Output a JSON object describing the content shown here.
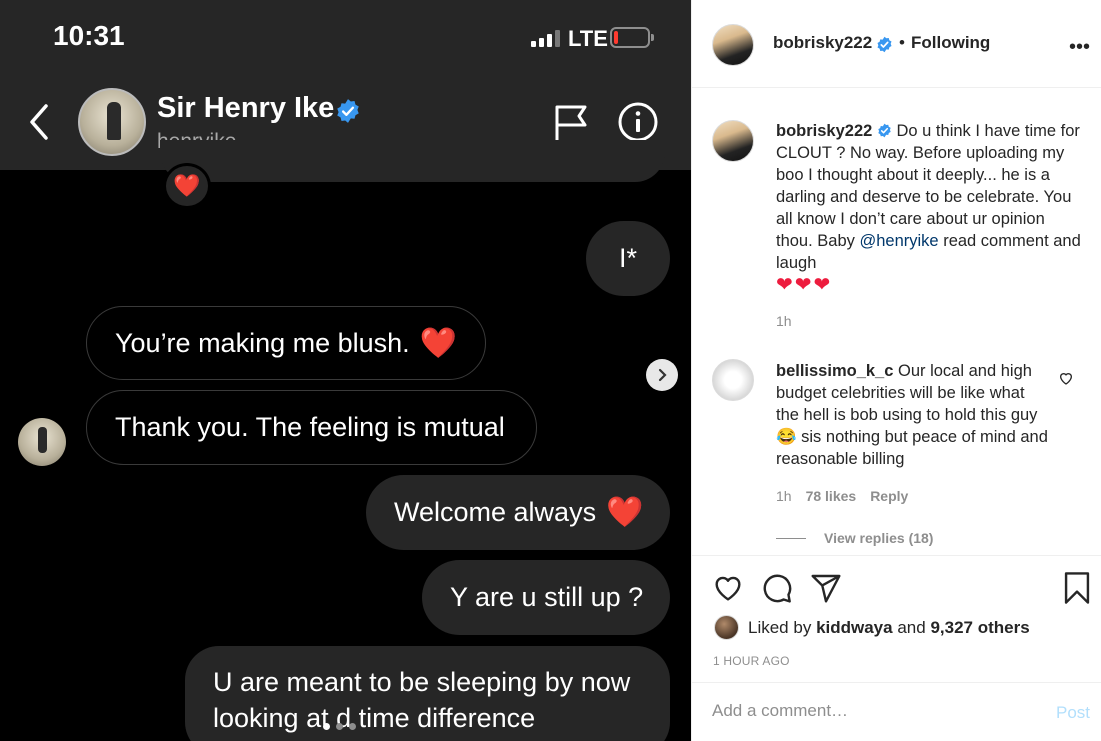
{
  "phone": {
    "status_time": "10:31",
    "network": "LTE",
    "battery_level": 0.1,
    "battery_color": "#ff3b30",
    "contact": {
      "name": "Sir Henry Ike",
      "handle": "henryike",
      "verified": true
    },
    "reaction_emoji": "❤️",
    "messages": [
      {
        "text": "I*",
        "side": "right"
      },
      {
        "text": "You’re making me blush.",
        "emoji": "❤️",
        "side": "left"
      },
      {
        "text": "Thank you. The feeling is mutual",
        "side": "left"
      },
      {
        "text": "Welcome always",
        "emoji": "❤️",
        "side": "right"
      },
      {
        "text": "Y are u still up ?",
        "side": "right"
      },
      {
        "text_line1": "U are meant to be sleeping by now",
        "text_line2": "looking at d time difference",
        "side": "right"
      }
    ],
    "carousel": {
      "slides": 3,
      "active": 1
    },
    "icons": [
      "chevron-left-icon",
      "flag-icon",
      "info-icon",
      "verified-badge-icon",
      "chevron-right-icon"
    ]
  },
  "post": {
    "header": {
      "username": "bobrisky222",
      "verified": true,
      "separator": "•",
      "follow_status": "Following",
      "more": "•••"
    },
    "caption": {
      "username": "bobrisky222",
      "text": "Do u think I have time for CLOUT ? No way. Before uploading my boo I thought about it deeply... he is a darling and deserve to be celebrate. You all know I don’t care about ur opinion thou. Baby",
      "mention": "@henryike",
      "text_after": "read comment and laugh",
      "hearts": "❤❤❤",
      "time": "1h"
    },
    "comment": {
      "username": "bellissimo_k_c",
      "text_before": "Our local and high budget celebrities will be like what the hell is bob using to hold this guy",
      "emoji": "😂",
      "text_after": "sis nothing but peace of mind and reasonable billing",
      "time": "1h",
      "likes": "78 likes",
      "reply": "Reply",
      "view_replies": "View replies (18)"
    },
    "likes": {
      "prefix": "Liked by",
      "user": "kiddwaya",
      "middle": "and",
      "count": "9,327 others"
    },
    "timestamp": "1 HOUR AGO",
    "add_comment": {
      "placeholder": "Add a comment…",
      "post_label": "Post"
    },
    "colors": {
      "link": "#00376b",
      "verified": "#3897f0",
      "heart": "#ed1c3e",
      "post_disabled": "#b2dffc"
    }
  }
}
